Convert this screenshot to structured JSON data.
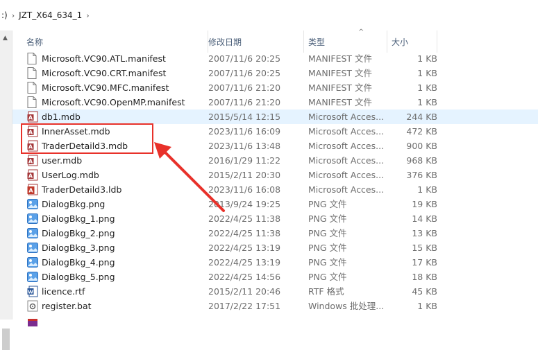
{
  "breadcrumb": {
    "prefix": ":)",
    "folder": "JZT_X64_634_1"
  },
  "columns": {
    "name": "名称",
    "date": "修改日期",
    "type": "类型",
    "size": "大小"
  },
  "files": [
    {
      "name": "Microsoft.VC90.ATL.manifest",
      "date": "2007/11/6 20:25",
      "type": "MANIFEST 文件",
      "size": "1 KB",
      "icon": "manifest-file-icon"
    },
    {
      "name": "Microsoft.VC90.CRT.manifest",
      "date": "2007/11/6 20:25",
      "type": "MANIFEST 文件",
      "size": "1 KB",
      "icon": "manifest-file-icon"
    },
    {
      "name": "Microsoft.VC90.MFC.manifest",
      "date": "2007/11/6 21:20",
      "type": "MANIFEST 文件",
      "size": "1 KB",
      "icon": "manifest-file-icon"
    },
    {
      "name": "Microsoft.VC90.OpenMP.manifest",
      "date": "2007/11/6 21:20",
      "type": "MANIFEST 文件",
      "size": "1 KB",
      "icon": "manifest-file-icon"
    },
    {
      "name": "db1.mdb",
      "date": "2015/5/14 12:15",
      "type": "Microsoft Acces...",
      "size": "244 KB",
      "icon": "access-mdb-icon",
      "highlighted": true
    },
    {
      "name": "InnerAsset.mdb",
      "date": "2023/11/6 16:09",
      "type": "Microsoft Acces...",
      "size": "472 KB",
      "icon": "access-mdb-icon"
    },
    {
      "name": "TraderDetaild3.mdb",
      "date": "2023/11/6 13:48",
      "type": "Microsoft Acces...",
      "size": "900 KB",
      "icon": "access-mdb-icon"
    },
    {
      "name": "user.mdb",
      "date": "2016/1/29 11:22",
      "type": "Microsoft Acces...",
      "size": "968 KB",
      "icon": "access-mdb-icon"
    },
    {
      "name": "UserLog.mdb",
      "date": "2015/2/11 20:30",
      "type": "Microsoft Acces...",
      "size": "376 KB",
      "icon": "access-mdb-icon"
    },
    {
      "name": "TraderDetaild3.ldb",
      "date": "2023/11/6 16:08",
      "type": "Microsoft Acces...",
      "size": "1 KB",
      "icon": "access-ldb-icon"
    },
    {
      "name": "DialogBkg.png",
      "date": "2013/9/24 19:25",
      "type": "PNG 文件",
      "size": "19 KB",
      "icon": "png-image-icon"
    },
    {
      "name": "DialogBkg_1.png",
      "date": "2022/4/25 11:38",
      "type": "PNG 文件",
      "size": "14 KB",
      "icon": "png-image-icon"
    },
    {
      "name": "DialogBkg_2.png",
      "date": "2022/4/25 11:38",
      "type": "PNG 文件",
      "size": "13 KB",
      "icon": "png-image-icon"
    },
    {
      "name": "DialogBkg_3.png",
      "date": "2022/4/25 13:19",
      "type": "PNG 文件",
      "size": "15 KB",
      "icon": "png-image-icon"
    },
    {
      "name": "DialogBkg_4.png",
      "date": "2022/4/25 13:19",
      "type": "PNG 文件",
      "size": "17 KB",
      "icon": "png-image-icon"
    },
    {
      "name": "DialogBkg_5.png",
      "date": "2022/4/25 14:56",
      "type": "PNG 文件",
      "size": "18 KB",
      "icon": "png-image-icon"
    },
    {
      "name": "licence.rtf",
      "date": "2015/2/11 20:46",
      "type": "RTF 格式",
      "size": "45 KB",
      "icon": "rtf-word-icon"
    },
    {
      "name": "register.bat",
      "date": "2017/2/22 17:51",
      "type": "Windows 批处理...",
      "size": "1 KB",
      "icon": "bat-gear-icon"
    },
    {
      "name": "",
      "date": "",
      "type": "",
      "size": "",
      "icon": "archive-icon"
    }
  ],
  "colors": {
    "accent_red": "#e8312a",
    "row_highlight": "#e5f3ff",
    "header_text": "#4c607a"
  }
}
